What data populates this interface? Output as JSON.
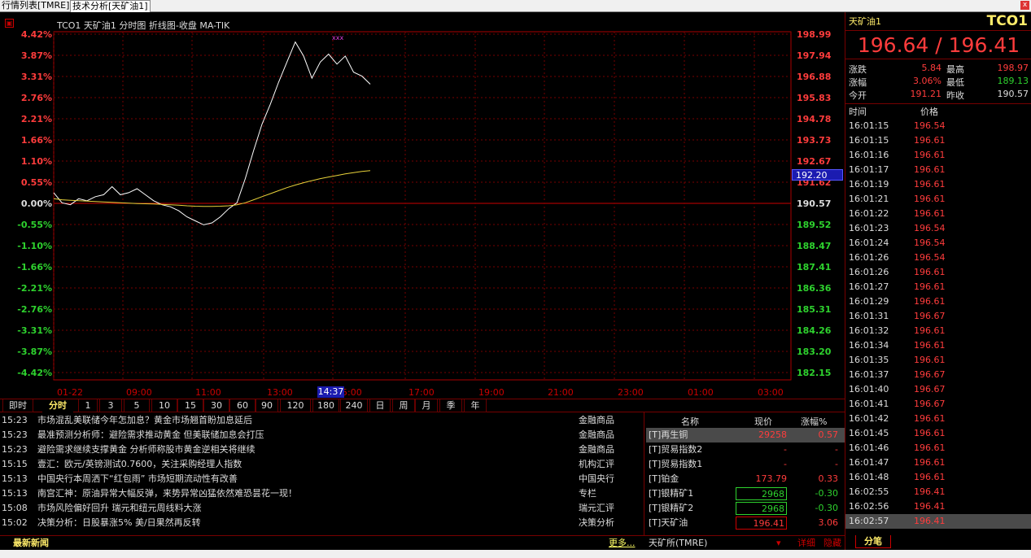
{
  "tabs": {
    "quote_list": "行情列表[TMRE]",
    "tech": "技术分析[天矿油1]",
    "close": "x"
  },
  "chart": {
    "title": "TCO1 天矿油1 分时图 折线图-收盘 MA-TIK",
    "current_price_tag": "192.20",
    "cursor_time": "14:37",
    "marker": "xxx",
    "pct_labels": [
      "4.42%",
      "3.87%",
      "3.31%",
      "2.76%",
      "2.21%",
      "1.66%",
      "1.10%",
      "0.55%",
      "0.00%",
      "-0.55%",
      "-1.10%",
      "-1.66%",
      "-2.21%",
      "-2.76%",
      "-3.31%",
      "-3.87%",
      "-4.42%"
    ],
    "price_labels": [
      "198.99",
      "197.94",
      "196.88",
      "195.83",
      "194.78",
      "193.73",
      "192.67",
      "191.62",
      "190.57",
      "189.52",
      "188.47",
      "187.41",
      "186.36",
      "185.31",
      "184.26",
      "183.20",
      "182.15"
    ],
    "time_labels": [
      "01-22",
      "09:00",
      "11:00",
      "13:00",
      "15:00",
      "17:00",
      "19:00",
      "21:00",
      "23:00",
      "01:00",
      "03:00"
    ]
  },
  "chart_data": {
    "type": "line",
    "prev_close": 190.57,
    "ylim": [
      182.15,
      198.99
    ],
    "xlabel_ticks": [
      "01-22",
      "09:00",
      "11:00",
      "13:00",
      "15:00",
      "17:00",
      "19:00",
      "21:00",
      "23:00",
      "01:00",
      "03:00"
    ],
    "series": [
      {
        "values": [
          191.1,
          190.6,
          190.5,
          190.8,
          190.7,
          190.9,
          191.0,
          191.4,
          191.0,
          191.1,
          191.3,
          191.0,
          190.7,
          190.5,
          190.4,
          190.2,
          189.9,
          189.7,
          189.5,
          189.6,
          189.9,
          190.3,
          190.6,
          191.8,
          193.2,
          194.5,
          195.5,
          196.6,
          197.6,
          198.6,
          197.9,
          196.8,
          197.6,
          198.0,
          197.5,
          197.9,
          197.1,
          196.9,
          196.5
        ]
      },
      {
        "values": [
          190.8,
          190.75,
          190.72,
          190.7,
          190.68,
          190.66,
          190.64,
          190.62,
          190.6,
          190.58,
          190.56,
          190.55,
          190.54,
          190.52,
          190.5,
          190.48,
          190.45,
          190.43,
          190.42,
          190.42,
          190.43,
          190.45,
          190.5,
          190.6,
          190.75,
          190.9,
          191.05,
          191.2,
          191.35,
          191.48,
          191.6,
          191.7,
          191.8,
          191.88,
          191.96,
          192.04,
          192.1,
          192.16,
          192.2
        ]
      }
    ]
  },
  "periods": [
    "即时",
    "分时",
    "1",
    "3",
    "5",
    "10",
    "15",
    "30",
    "60",
    "90",
    "120",
    "180",
    "240",
    "日",
    "周",
    "月",
    "季",
    "年"
  ],
  "news": [
    {
      "time": "15:23",
      "headline": "市场混乱美联储今年怎加息？黄金市场翘首盼加息延后",
      "cat": "金融商品"
    },
    {
      "time": "15:23",
      "headline": "最准预测分析师：避险需求推动黄金 但美联储加息会打压",
      "cat": "金融商品"
    },
    {
      "time": "15:23",
      "headline": "避险需求继续支撑黄金 分析师称股市黄金逆相关将继续",
      "cat": "金融商品"
    },
    {
      "time": "15:15",
      "headline": "壹汇：欧元/英镑测试0.7600，关注采购经理人指数",
      "cat": "机构汇评"
    },
    {
      "time": "15:13",
      "headline": "中国央行本周洒下“红包雨” 市场短期流动性有改善",
      "cat": "中国央行"
    },
    {
      "time": "15:13",
      "headline": "南宫汇神：原油异常大幅反弹，来势异常凶猛依然难恐昙花一现！",
      "cat": "专栏"
    },
    {
      "time": "15:08",
      "headline": "市场风险偏好回升 瑞元和纽元周线料大涨",
      "cat": "瑞元汇评"
    },
    {
      "time": "15:02",
      "headline": "决策分析：日股暴涨5% 美/日果然再反转",
      "cat": "决策分析"
    }
  ],
  "news_bar": {
    "label": "最新新闻",
    "more": "更多..."
  },
  "watchlist": {
    "headers": [
      "名称",
      "现价",
      "涨幅%"
    ],
    "rows": [
      {
        "name": "[T]再生铜",
        "price": "29258",
        "chg": "0.57"
      },
      {
        "name": "[T]贸易指数2",
        "price": "-",
        "chg": "-"
      },
      {
        "name": "[T]贸易指数1",
        "price": "-",
        "chg": "-"
      },
      {
        "name": "[T]铂金",
        "price": "173.79",
        "chg": "0.33"
      },
      {
        "name": "[T]银精矿1",
        "price": "2968",
        "chg": "-0.30"
      },
      {
        "name": "[T]银精矿2",
        "price": "2968",
        "chg": "-0.30"
      },
      {
        "name": "[T]天矿油",
        "price": "196.41",
        "chg": "3.06"
      }
    ],
    "exchange": "天矿所(TMRE)",
    "detail": "详细",
    "mute": "隐藏"
  },
  "quote": {
    "name": "天矿油1",
    "code": "TCO1",
    "price_pair": "196.64 / 196.41",
    "rows": [
      {
        "l1": "涨跌",
        "v1": "5.84",
        "l2": "最高",
        "v2": "198.97"
      },
      {
        "l1": "涨幅",
        "v1": "3.06%",
        "l2": "最低",
        "v2": "189.13"
      },
      {
        "l1": "今开",
        "v1": "191.21",
        "l2": "昨收",
        "v2": "190.57"
      }
    ],
    "tick_headers": [
      "时间",
      "价格"
    ],
    "ticks": [
      [
        "16:01:15",
        "196.54"
      ],
      [
        "16:01:15",
        "196.61"
      ],
      [
        "16:01:16",
        "196.61"
      ],
      [
        "16:01:17",
        "196.61"
      ],
      [
        "16:01:19",
        "196.61"
      ],
      [
        "16:01:21",
        "196.61"
      ],
      [
        "16:01:22",
        "196.61"
      ],
      [
        "16:01:23",
        "196.54"
      ],
      [
        "16:01:24",
        "196.54"
      ],
      [
        "16:01:26",
        "196.54"
      ],
      [
        "16:01:26",
        "196.61"
      ],
      [
        "16:01:27",
        "196.61"
      ],
      [
        "16:01:29",
        "196.61"
      ],
      [
        "16:01:31",
        "196.67"
      ],
      [
        "16:01:32",
        "196.61"
      ],
      [
        "16:01:34",
        "196.61"
      ],
      [
        "16:01:35",
        "196.61"
      ],
      [
        "16:01:37",
        "196.67"
      ],
      [
        "16:01:40",
        "196.67"
      ],
      [
        "16:01:41",
        "196.67"
      ],
      [
        "16:01:42",
        "196.61"
      ],
      [
        "16:01:45",
        "196.61"
      ],
      [
        "16:01:46",
        "196.61"
      ],
      [
        "16:01:47",
        "196.61"
      ],
      [
        "16:01:48",
        "196.61"
      ],
      [
        "16:02:55",
        "196.41"
      ],
      [
        "16:02:56",
        "196.41"
      ],
      [
        "16:02:57",
        "196.41"
      ]
    ],
    "tab": "分笔"
  }
}
